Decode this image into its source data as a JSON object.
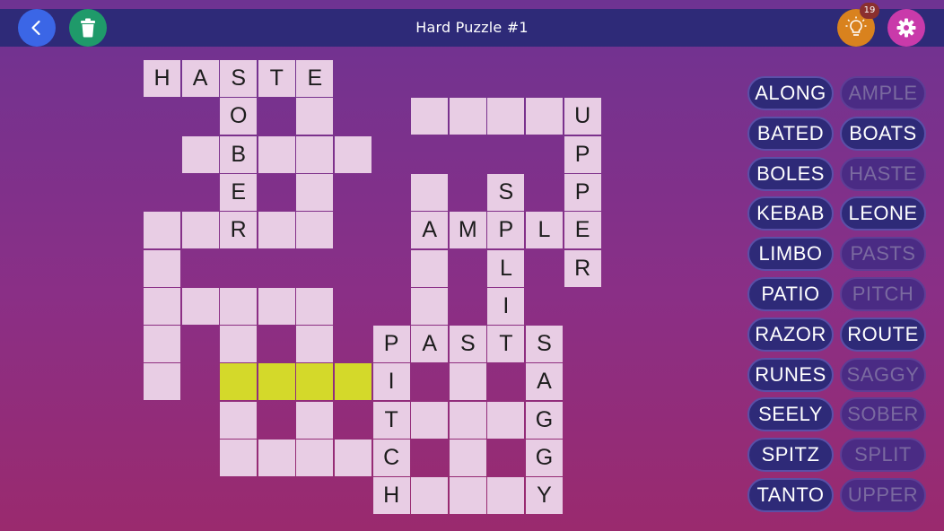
{
  "header": {
    "title": "Hard Puzzle #1",
    "hint_count": "19",
    "icons": {
      "back": "chevron-left-icon",
      "trash": "trash-icon",
      "hint": "lightbulb-icon",
      "settings": "gear-icon"
    }
  },
  "colors": {
    "background_top": "#6e3392",
    "background_bottom": "#9a2a6e",
    "topbar": "#2e2a78",
    "cell": "#e8cde4",
    "highlight": "#d4d92a",
    "word_pill": "#2e2a78"
  },
  "grid": {
    "cells": [
      {
        "r": 0,
        "c": 0,
        "ch": "H"
      },
      {
        "r": 0,
        "c": 1,
        "ch": "A"
      },
      {
        "r": 0,
        "c": 2,
        "ch": "S"
      },
      {
        "r": 0,
        "c": 3,
        "ch": "T"
      },
      {
        "r": 0,
        "c": 4,
        "ch": "E"
      },
      {
        "r": 1,
        "c": 2,
        "ch": "O"
      },
      {
        "r": 1,
        "c": 4,
        "ch": ""
      },
      {
        "r": 1,
        "c": 7,
        "ch": ""
      },
      {
        "r": 1,
        "c": 8,
        "ch": ""
      },
      {
        "r": 1,
        "c": 9,
        "ch": ""
      },
      {
        "r": 1,
        "c": 10,
        "ch": ""
      },
      {
        "r": 1,
        "c": 11,
        "ch": "U"
      },
      {
        "r": 2,
        "c": 1,
        "ch": ""
      },
      {
        "r": 2,
        "c": 2,
        "ch": "B"
      },
      {
        "r": 2,
        "c": 3,
        "ch": ""
      },
      {
        "r": 2,
        "c": 4,
        "ch": ""
      },
      {
        "r": 2,
        "c": 5,
        "ch": ""
      },
      {
        "r": 2,
        "c": 11,
        "ch": "P"
      },
      {
        "r": 3,
        "c": 2,
        "ch": "E"
      },
      {
        "r": 3,
        "c": 4,
        "ch": ""
      },
      {
        "r": 3,
        "c": 7,
        "ch": ""
      },
      {
        "r": 3,
        "c": 9,
        "ch": "S"
      },
      {
        "r": 3,
        "c": 11,
        "ch": "P"
      },
      {
        "r": 4,
        "c": 0,
        "ch": ""
      },
      {
        "r": 4,
        "c": 1,
        "ch": ""
      },
      {
        "r": 4,
        "c": 2,
        "ch": "R"
      },
      {
        "r": 4,
        "c": 3,
        "ch": ""
      },
      {
        "r": 4,
        "c": 4,
        "ch": ""
      },
      {
        "r": 4,
        "c": 7,
        "ch": "A"
      },
      {
        "r": 4,
        "c": 8,
        "ch": "M"
      },
      {
        "r": 4,
        "c": 9,
        "ch": "P"
      },
      {
        "r": 4,
        "c": 10,
        "ch": "L"
      },
      {
        "r": 4,
        "c": 11,
        "ch": "E"
      },
      {
        "r": 5,
        "c": 0,
        "ch": ""
      },
      {
        "r": 5,
        "c": 7,
        "ch": ""
      },
      {
        "r": 5,
        "c": 9,
        "ch": "L"
      },
      {
        "r": 5,
        "c": 11,
        "ch": "R"
      },
      {
        "r": 6,
        "c": 0,
        "ch": ""
      },
      {
        "r": 6,
        "c": 1,
        "ch": ""
      },
      {
        "r": 6,
        "c": 2,
        "ch": ""
      },
      {
        "r": 6,
        "c": 3,
        "ch": ""
      },
      {
        "r": 6,
        "c": 4,
        "ch": ""
      },
      {
        "r": 6,
        "c": 7,
        "ch": ""
      },
      {
        "r": 6,
        "c": 9,
        "ch": "I"
      },
      {
        "r": 7,
        "c": 0,
        "ch": ""
      },
      {
        "r": 7,
        "c": 2,
        "ch": ""
      },
      {
        "r": 7,
        "c": 4,
        "ch": ""
      },
      {
        "r": 7,
        "c": 6,
        "ch": "P"
      },
      {
        "r": 7,
        "c": 7,
        "ch": "A"
      },
      {
        "r": 7,
        "c": 8,
        "ch": "S"
      },
      {
        "r": 7,
        "c": 9,
        "ch": "T"
      },
      {
        "r": 7,
        "c": 10,
        "ch": "S"
      },
      {
        "r": 8,
        "c": 0,
        "ch": ""
      },
      {
        "r": 8,
        "c": 2,
        "ch": "",
        "hl": true
      },
      {
        "r": 8,
        "c": 3,
        "ch": "",
        "hl": true
      },
      {
        "r": 8,
        "c": 4,
        "ch": "",
        "hl": true
      },
      {
        "r": 8,
        "c": 5,
        "ch": "",
        "hl": true
      },
      {
        "r": 8,
        "c": 6,
        "ch": "I"
      },
      {
        "r": 8,
        "c": 8,
        "ch": ""
      },
      {
        "r": 8,
        "c": 10,
        "ch": "A"
      },
      {
        "r": 9,
        "c": 2,
        "ch": ""
      },
      {
        "r": 9,
        "c": 4,
        "ch": ""
      },
      {
        "r": 9,
        "c": 6,
        "ch": "T"
      },
      {
        "r": 9,
        "c": 7,
        "ch": ""
      },
      {
        "r": 9,
        "c": 8,
        "ch": ""
      },
      {
        "r": 9,
        "c": 9,
        "ch": ""
      },
      {
        "r": 9,
        "c": 10,
        "ch": "G"
      },
      {
        "r": 10,
        "c": 2,
        "ch": ""
      },
      {
        "r": 10,
        "c": 3,
        "ch": ""
      },
      {
        "r": 10,
        "c": 4,
        "ch": ""
      },
      {
        "r": 10,
        "c": 5,
        "ch": ""
      },
      {
        "r": 10,
        "c": 6,
        "ch": "C"
      },
      {
        "r": 10,
        "c": 8,
        "ch": ""
      },
      {
        "r": 10,
        "c": 10,
        "ch": "G"
      },
      {
        "r": 11,
        "c": 6,
        "ch": "H"
      },
      {
        "r": 11,
        "c": 7,
        "ch": ""
      },
      {
        "r": 11,
        "c": 8,
        "ch": ""
      },
      {
        "r": 11,
        "c": 9,
        "ch": ""
      },
      {
        "r": 11,
        "c": 10,
        "ch": "Y"
      }
    ]
  },
  "word_list": {
    "left": [
      {
        "word": "ALONG",
        "used": false
      },
      {
        "word": "BATED",
        "used": false
      },
      {
        "word": "BOLES",
        "used": false
      },
      {
        "word": "KEBAB",
        "used": false
      },
      {
        "word": "LIMBO",
        "used": false
      },
      {
        "word": "PATIO",
        "used": false
      },
      {
        "word": "RAZOR",
        "used": false
      },
      {
        "word": "RUNES",
        "used": false
      },
      {
        "word": "SEELY",
        "used": false
      },
      {
        "word": "SPITZ",
        "used": false
      },
      {
        "word": "TANTO",
        "used": false
      }
    ],
    "right": [
      {
        "word": "AMPLE",
        "used": true
      },
      {
        "word": "BOATS",
        "used": false
      },
      {
        "word": "HASTE",
        "used": true
      },
      {
        "word": "LEONE",
        "used": false
      },
      {
        "word": "PASTS",
        "used": true
      },
      {
        "word": "PITCH",
        "used": true
      },
      {
        "word": "ROUTE",
        "used": false
      },
      {
        "word": "SAGGY",
        "used": true
      },
      {
        "word": "SOBER",
        "used": true
      },
      {
        "word": "SPLIT",
        "used": true
      },
      {
        "word": "UPPER",
        "used": true
      }
    ]
  }
}
